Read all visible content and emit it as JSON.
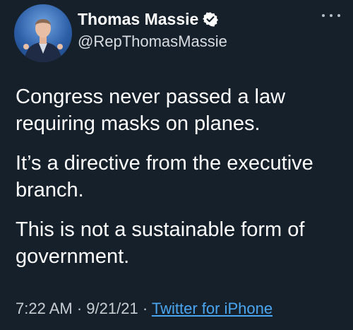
{
  "tweet": {
    "author": {
      "display_name": "Thomas Massie",
      "handle": "@RepThomasMassie",
      "verified": true
    },
    "paragraphs": [
      "Congress never passed a law requiring masks on planes.",
      "It’s a directive from the executive branch.",
      "This is not a sustainable form of government."
    ],
    "time": "7:22 AM",
    "date": "9/21/21",
    "separator": "·",
    "source": "Twitter for iPhone"
  },
  "icons": {
    "verified": "verified-badge-icon",
    "more": "more-options-icon"
  },
  "colors": {
    "background": "#15202b",
    "text": "#ffffff",
    "secondary_text": "#c8cdd2",
    "link": "#4aa6f0"
  }
}
